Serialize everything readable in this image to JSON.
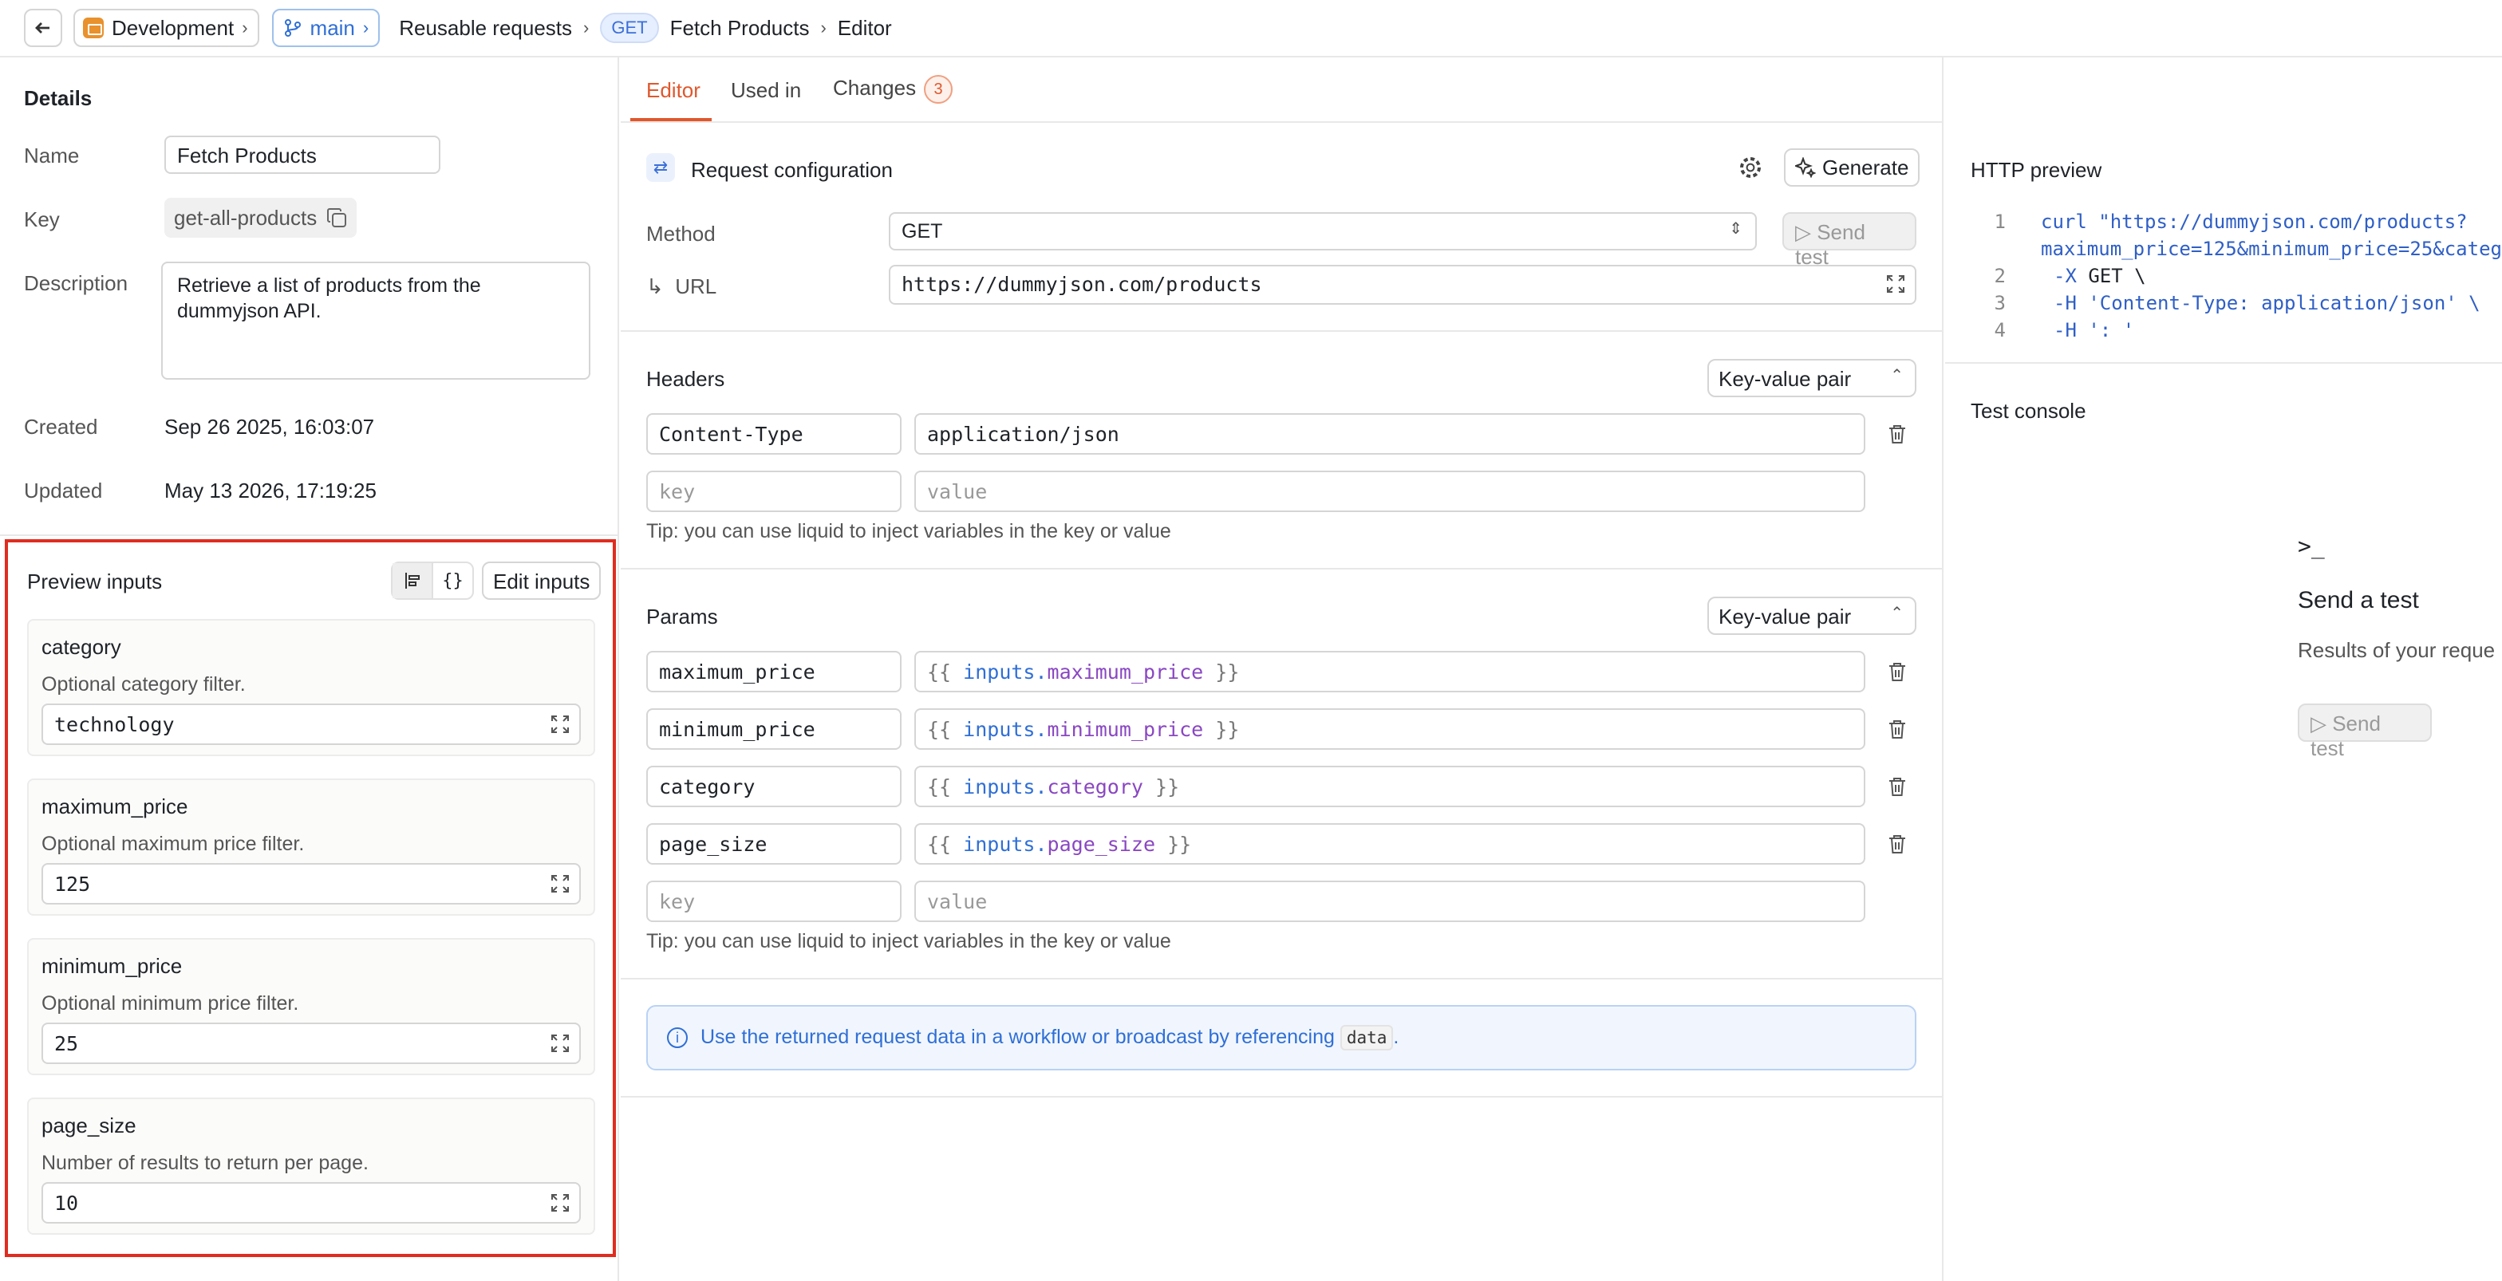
{
  "topbar": {
    "environment": "Development",
    "branch": "main",
    "crumb_section": "Reusable requests",
    "method_badge": "GET",
    "crumb_request": "Fetch Products",
    "crumb_page": "Editor"
  },
  "details": {
    "title": "Details",
    "name_label": "Name",
    "name_value": "Fetch Products",
    "key_label": "Key",
    "key_value": "get-all-products",
    "description_label": "Description",
    "description_value": "Retrieve a list of products from the dummyjson API.",
    "created_label": "Created",
    "created_value": "Sep 26 2025, 16:03:07",
    "updated_label": "Updated",
    "updated_value": "May 13 2026, 17:19:25"
  },
  "preview_inputs": {
    "title": "Preview inputs",
    "json_toggle": "{}",
    "edit_button": "Edit inputs",
    "inputs": [
      {
        "name": "category",
        "description": "Optional category filter.",
        "value": "technology"
      },
      {
        "name": "maximum_price",
        "description": "Optional maximum price filter.",
        "value": "125"
      },
      {
        "name": "minimum_price",
        "description": "Optional minimum price filter.",
        "value": "25"
      },
      {
        "name": "page_size",
        "description": "Number of results to return per page.",
        "value": "10"
      }
    ]
  },
  "tabs": {
    "editor": "Editor",
    "used_in": "Used in",
    "changes": "Changes",
    "changes_count": "3"
  },
  "request_config": {
    "title": "Request configuration",
    "generate_button": "Generate",
    "method_label": "Method",
    "method_value": "GET",
    "send_test": "Send test",
    "url_label": "URL",
    "url_value": "https://dummyjson.com/products"
  },
  "headers": {
    "title": "Headers",
    "mode": "Key-value pair",
    "rows": [
      {
        "key": "Content-Type",
        "value": "application/json"
      }
    ],
    "key_placeholder": "key",
    "value_placeholder": "value",
    "tip": "Tip: you can use liquid to inject variables in the key or value"
  },
  "params": {
    "title": "Params",
    "mode": "Key-value pair",
    "rows": [
      {
        "key": "maximum_price",
        "open": "{{",
        "ns": "inputs",
        "dot": ".",
        "var": "maximum_price",
        "close": "}}"
      },
      {
        "key": "minimum_price",
        "open": "{{",
        "ns": "inputs",
        "dot": ".",
        "var": "minimum_price",
        "close": "}}"
      },
      {
        "key": "category",
        "open": "{{",
        "ns": "inputs",
        "dot": ".",
        "var": "category",
        "close": "}}"
      },
      {
        "key": "page_size",
        "open": "{{",
        "ns": "inputs",
        "dot": ".",
        "var": "page_size",
        "close": "}}"
      }
    ],
    "key_placeholder": "key",
    "value_placeholder": "value",
    "tip": "Tip: you can use liquid to inject variables in the key or value"
  },
  "info": {
    "text": "Use the returned request data in a workflow or broadcast by referencing",
    "code": "data",
    "suffix": "."
  },
  "http_preview": {
    "title": "HTTP preview",
    "lines": [
      {
        "num": "1",
        "text": "curl \"https://dummyjson.com/products?"
      },
      {
        "num": "",
        "text": "maximum_price=125&minimum_price=25&categ"
      },
      {
        "num": "2",
        "flag": "-X",
        "text": " GET \\"
      },
      {
        "num": "3",
        "flag": "-H",
        "text": " 'Content-Type: application/json' \\"
      },
      {
        "num": "4",
        "flag": "-H",
        "text": " ': '"
      }
    ]
  },
  "test_console": {
    "title": "Test console",
    "prompt_icon": ">_",
    "heading": "Send a test",
    "subtext": "Results of your reque",
    "button": "Send test"
  },
  "colors": {
    "accent": "#e0572c",
    "link_blue": "#2f6fd6",
    "highlight_border": "#e02c20",
    "liquid_var": "#8a47c2"
  }
}
